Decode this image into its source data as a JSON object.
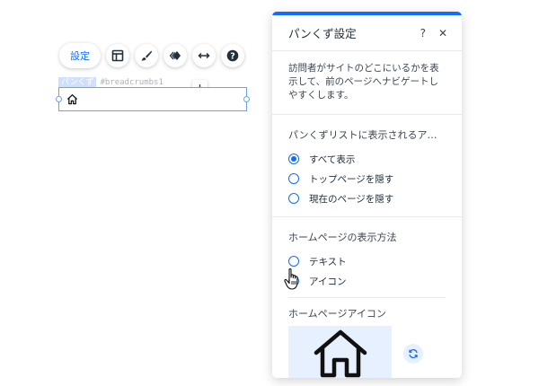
{
  "toolbar": {
    "settings_label": "設定",
    "icons": [
      "layout-icon",
      "brush-icon",
      "animation-icon",
      "stretch-icon",
      "help-icon"
    ]
  },
  "element": {
    "name_tag": "パンくず",
    "id_tag": "#breadcrumbs1"
  },
  "panel": {
    "title": "パンくず設定",
    "help_glyph": "?",
    "close_glyph": "✕",
    "intro": "訪問者がサイトのどこにいるかを表示して、前のページへナビゲートしやすくします。",
    "list_section": {
      "title": "パンくずリストに表示されるア…",
      "options": [
        {
          "label": "すべて表示",
          "checked": true
        },
        {
          "label": "トップページを隠す",
          "checked": false
        },
        {
          "label": "現在のページを隠す",
          "checked": false
        }
      ]
    },
    "home_display": {
      "title": "ホームページの表示方法",
      "options": [
        {
          "label": "テキスト",
          "checked": false
        },
        {
          "label": "アイコン",
          "checked": true
        }
      ]
    },
    "home_icon": {
      "title": "ホームページアイコン"
    }
  },
  "colors": {
    "accent": "#116dff",
    "preview_bg": "#e7f0ff"
  }
}
